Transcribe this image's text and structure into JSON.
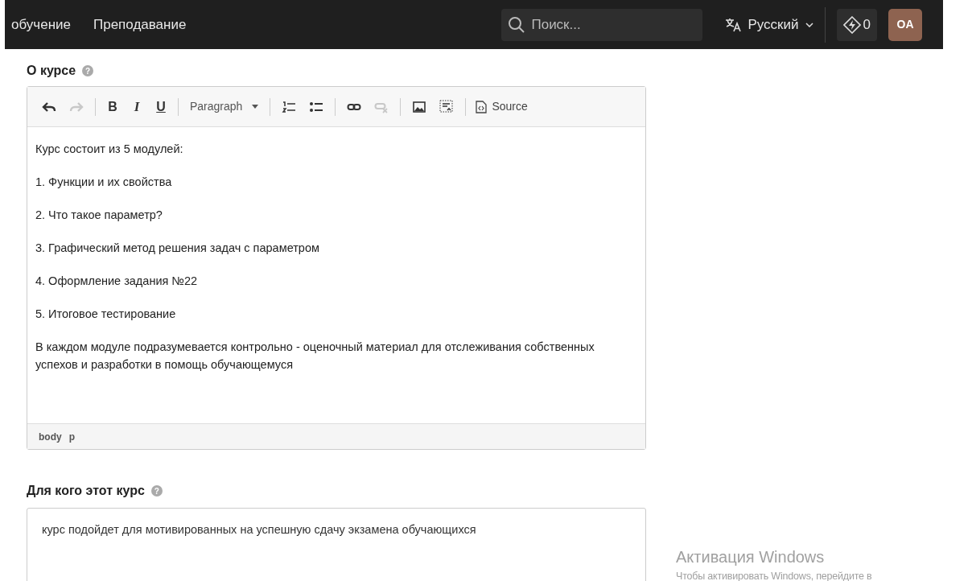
{
  "nav": {
    "links": [
      "обучение",
      "Преподавание"
    ],
    "search": {
      "placeholder": "Поиск..."
    },
    "language": "Русский",
    "points": "0",
    "avatar": "OA"
  },
  "about": {
    "title": "О курсе",
    "help": "?",
    "toolbar": [
      {
        "kind": "undo",
        "disabled": false
      },
      {
        "kind": "redo",
        "disabled": true
      },
      {
        "kind": "sep"
      },
      {
        "kind": "bold",
        "label": "B"
      },
      {
        "kind": "italic",
        "label": "I"
      },
      {
        "kind": "underline",
        "label": "U"
      },
      {
        "kind": "sep"
      },
      {
        "kind": "dropdown",
        "label": "Paragraph"
      },
      {
        "kind": "sep"
      },
      {
        "kind": "ol"
      },
      {
        "kind": "ul"
      },
      {
        "kind": "sep"
      },
      {
        "kind": "link",
        "disabled": false
      },
      {
        "kind": "unlink",
        "disabled": true
      },
      {
        "kind": "sep"
      },
      {
        "kind": "image"
      },
      {
        "kind": "embed"
      },
      {
        "kind": "sep"
      },
      {
        "kind": "source",
        "label": "Source"
      }
    ],
    "paragraphs": [
      "Курс состоит из 5 модулей:",
      "1. Функции и их свойства",
      "2. Что такое параметр?",
      "3. Графический метод решения задач с параметром",
      "4. Оформление задания №22",
      "5. Итоговое тестирование",
      "В каждом модуле подразумевается контрольно - оценочный материал для отслеживания собственных успехов и разработки в помощь обучающемуся"
    ],
    "path": [
      "body",
      "p"
    ]
  },
  "audience": {
    "title": "Для кого этот курс",
    "help": "?",
    "value": "курс подойдет для мотивированных на успешную сдачу экзамена обучающихся"
  },
  "os_notice": [
    "Активация Windows",
    "Чтобы активировать Windows, перейдите в"
  ]
}
